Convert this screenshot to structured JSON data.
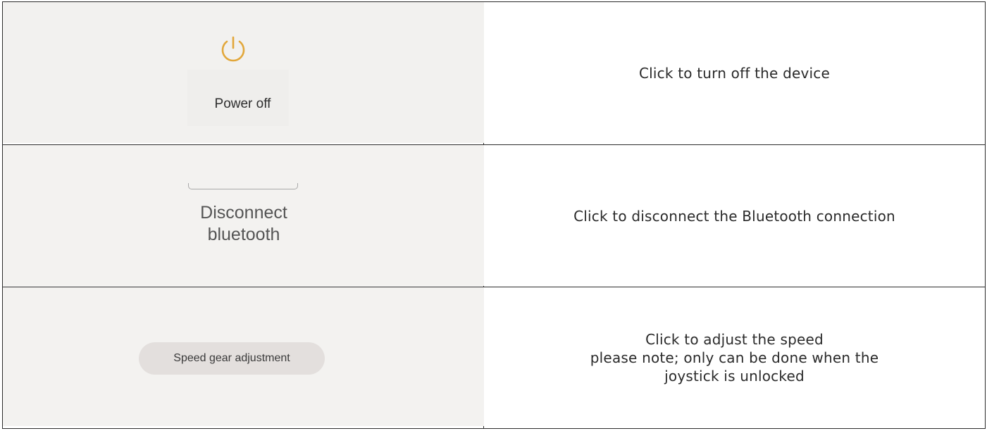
{
  "rows": [
    {
      "control": {
        "icon": "power-icon",
        "icon_color": "#e2a73a",
        "label": "Power off"
      },
      "description": "Click to turn off the device"
    },
    {
      "control": {
        "label_line1": "Disconnect",
        "label_line2": "bluetooth"
      },
      "description": "Click to disconnect the Bluetooth connection"
    },
    {
      "control": {
        "label": "Speed gear adjustment"
      },
      "description_lines": [
        "Click to adjust the speed",
        "please note; only can be done when the",
        "joystick is unlocked"
      ]
    }
  ]
}
